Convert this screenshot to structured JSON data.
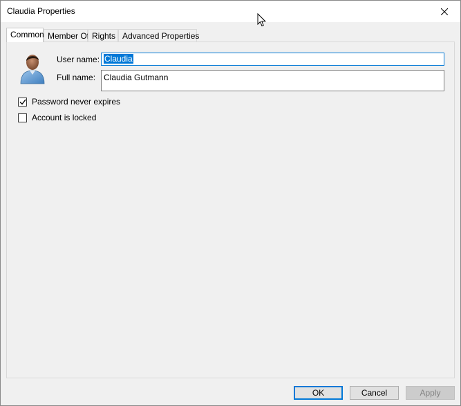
{
  "window": {
    "title": "Claudia Properties"
  },
  "tabs": [
    {
      "label": "Common",
      "active": true
    },
    {
      "label": "Member Of",
      "active": false
    },
    {
      "label": "Rights",
      "active": false
    },
    {
      "label": "Advanced Properties",
      "active": false
    }
  ],
  "form": {
    "user_name_label": "User name:",
    "user_name_value": "Claudia",
    "full_name_label": "Full name:",
    "full_name_value": "Claudia Gutmann"
  },
  "options": {
    "password_never_expires": {
      "label": "Password never expires",
      "checked": true
    },
    "account_locked": {
      "label": "Account is locked",
      "checked": false
    }
  },
  "buttons": {
    "ok": "OK",
    "cancel": "Cancel",
    "apply": "Apply"
  },
  "colors": {
    "accent": "#0078d7",
    "panel": "#f0f0f0"
  },
  "icons": {
    "avatar": "user-avatar-icon",
    "close": "close-icon",
    "check": "checkmark-icon"
  }
}
